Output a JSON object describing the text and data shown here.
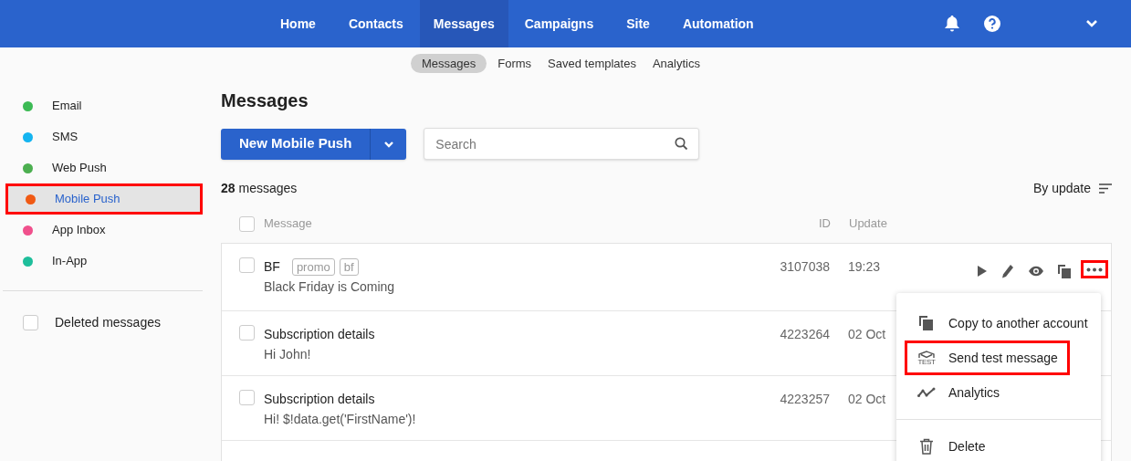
{
  "top_nav": {
    "items": [
      {
        "label": "Home",
        "selected": false
      },
      {
        "label": "Contacts",
        "selected": false
      },
      {
        "label": "Messages",
        "selected": true
      },
      {
        "label": "Campaigns",
        "selected": false
      },
      {
        "label": "Site",
        "selected": false
      },
      {
        "label": "Automation",
        "selected": false
      }
    ]
  },
  "sub_nav": {
    "items": [
      {
        "label": "Messages",
        "selected": true
      },
      {
        "label": "Forms",
        "selected": false
      },
      {
        "label": "Saved templates",
        "selected": false
      },
      {
        "label": "Analytics",
        "selected": false
      }
    ]
  },
  "sidebar": {
    "items": [
      {
        "label": "Email",
        "color": "#3cba54",
        "selected": false,
        "highlighted": false
      },
      {
        "label": "SMS",
        "color": "#14b4f0",
        "selected": false,
        "highlighted": false
      },
      {
        "label": "Web Push",
        "color": "#4caf50",
        "selected": false,
        "highlighted": false
      },
      {
        "label": "Mobile Push",
        "color": "#f05a14",
        "selected": true,
        "highlighted": true
      },
      {
        "label": "App Inbox",
        "color": "#f0508c",
        "selected": false,
        "highlighted": false
      },
      {
        "label": "In-App",
        "color": "#1ebe9b",
        "selected": false,
        "highlighted": false
      }
    ],
    "deleted": {
      "label": "Deleted messages",
      "checked": false
    }
  },
  "title": "Messages",
  "new_button": "New Mobile Push",
  "search": {
    "placeholder": "Search"
  },
  "count": {
    "number": "28",
    "label": "messages"
  },
  "sort": "By update",
  "table": {
    "columns": [
      "Message",
      "ID",
      "Update"
    ],
    "all_checked": false,
    "rows": [
      {
        "title": "BF",
        "tags": [
          "promo",
          "bf"
        ],
        "text": "Black Friday is Coming",
        "id": "3107038",
        "update": "19:23",
        "checked": false
      },
      {
        "title": "Subscription details",
        "tags": [],
        "text": "Hi John!",
        "id": "4223264",
        "update": "02 Oct",
        "checked": false
      },
      {
        "title": "Subscription details",
        "tags": [],
        "text": "Hi! $!data.get('FirstName')!",
        "id": "4223257",
        "update": "02 Oct",
        "checked": false
      }
    ]
  },
  "row_actions": {
    "more_highlighted": true
  },
  "menu": {
    "items": [
      {
        "kind": "copy",
        "label": "Copy to another account",
        "highlighted": false
      },
      {
        "kind": "test",
        "label": "Send test message",
        "icon_text": "TEST",
        "highlighted": true
      },
      {
        "kind": "analytics",
        "label": "Analytics",
        "highlighted": false
      },
      {
        "kind": "delete",
        "label": "Delete",
        "highlighted": false
      }
    ]
  }
}
